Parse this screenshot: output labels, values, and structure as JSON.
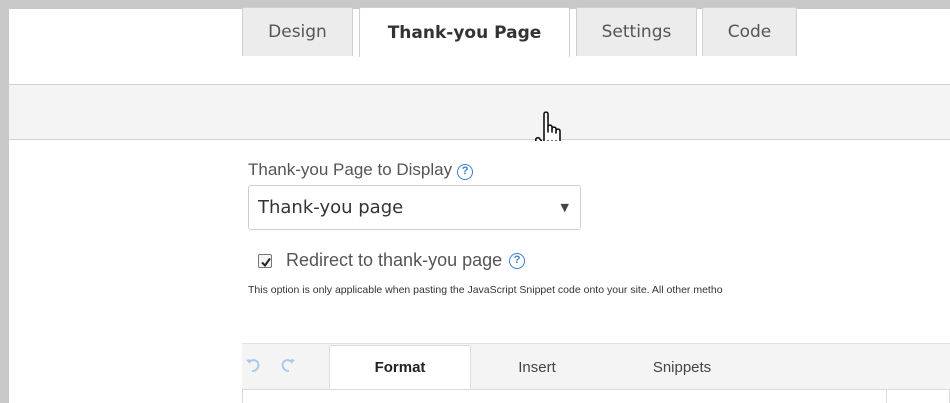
{
  "tabs": [
    {
      "label": "Design",
      "active": false
    },
    {
      "label": "Thank-you Page",
      "active": true
    },
    {
      "label": "Settings",
      "active": false
    },
    {
      "label": "Code",
      "active": false
    }
  ],
  "thankyou": {
    "label": "Thank-you Page to Display",
    "help_icon": "question-circle-icon",
    "selected": "Thank-you page"
  },
  "redirect": {
    "checked": true,
    "label": "Redirect to thank-you page",
    "note": "This option is only applicable when pasting the JavaScript Snippet code onto your site. All other metho"
  },
  "editor": {
    "tabs": [
      {
        "label": "Format",
        "active": true
      },
      {
        "label": "Insert",
        "active": false
      },
      {
        "label": "Snippets",
        "active": false
      }
    ],
    "icons": [
      "undo-icon",
      "redo-icon"
    ]
  },
  "colors": {
    "accent": "#3a7fd0",
    "frame": "#c8c8c8",
    "tabbar": "#f4f4f4"
  }
}
